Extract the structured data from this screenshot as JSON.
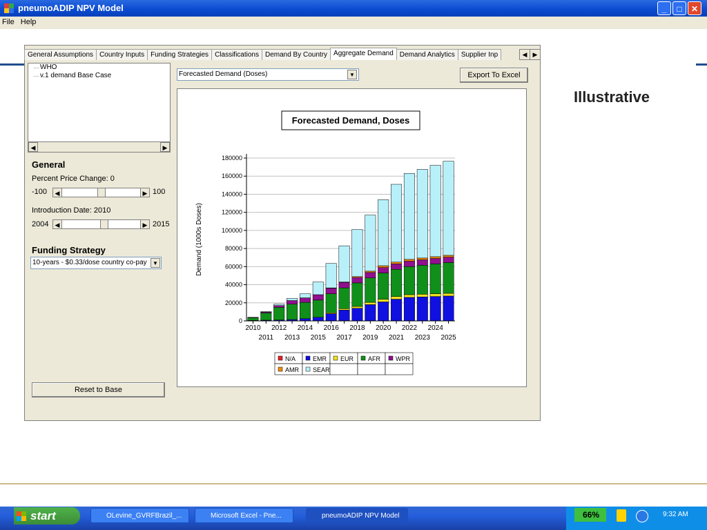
{
  "window": {
    "title": "pneumoADIP NPV Model"
  },
  "menu": [
    "File",
    "Help"
  ],
  "tabs": [
    "General Assumptions",
    "Country Inputs",
    "Funding Strategies",
    "Classifications",
    "Demand By Country",
    "Aggregate Demand",
    "Demand Analytics",
    "Supplier Inp"
  ],
  "tree": [
    "WHO",
    "v.1 demand Base Case"
  ],
  "general": {
    "heading": "General",
    "price_label": "Percent Price Change:",
    "price_value": "0",
    "price_min": "-100",
    "price_max": "100",
    "intro_label": "Introduction Date:",
    "intro_value": "2010",
    "intro_min": "2004",
    "intro_max": "2015",
    "price_slider_level": 0.5,
    "intro_slider_level": 0.5454
  },
  "funding": {
    "heading": "Funding Strategy",
    "value": "10-years - $0.33/dose country co-pay"
  },
  "reset_label": "Reset to Base",
  "view_select": "Forecasted Demand (Doses)",
  "export_label": "Export To Excel",
  "side_text": "Illustrative",
  "chart_data": {
    "type": "bar",
    "stacked": true,
    "title": "Forecasted Demand, Doses",
    "ylabel": "Demand (1000s Doses)",
    "xlabel": "",
    "ylim": [
      0,
      180000
    ],
    "yticks": [
      0,
      20000,
      40000,
      60000,
      80000,
      100000,
      120000,
      140000,
      160000,
      180000
    ],
    "categories": [
      "2010",
      "2011",
      "2012",
      "2013",
      "2014",
      "2015",
      "2016",
      "2017",
      "2018",
      "2019",
      "2020",
      "2021",
      "2022",
      "2023",
      "2024",
      "2025"
    ],
    "series": [
      {
        "name": "N/A",
        "color": "#e8202a",
        "values": [
          0,
          0,
          0,
          0,
          0,
          0,
          0,
          0,
          0,
          0,
          0,
          0,
          0,
          0,
          0,
          0
        ]
      },
      {
        "name": "EMR",
        "color": "#1010e0",
        "values": [
          500,
          800,
          1000,
          1500,
          2500,
          4000,
          8000,
          12000,
          14000,
          18000,
          21000,
          24000,
          26000,
          26500,
          27000,
          27500
        ]
      },
      {
        "name": "EUR",
        "color": "#f0e020",
        "values": [
          0,
          0,
          0,
          0,
          0,
          0,
          1000,
          1500,
          2000,
          2500,
          3000,
          3000,
          3000,
          3000,
          3000,
          3000
        ]
      },
      {
        "name": "AFR",
        "color": "#10901a",
        "values": [
          3000,
          8000,
          14000,
          17000,
          18000,
          19000,
          21000,
          23000,
          26000,
          27000,
          29000,
          30000,
          31000,
          32000,
          33000,
          34000
        ]
      },
      {
        "name": "WPR",
        "color": "#901090",
        "values": [
          500,
          1000,
          2000,
          4000,
          5000,
          6000,
          6000,
          6000,
          6000,
          6000,
          6000,
          6000,
          6000,
          6000,
          6000,
          6000
        ]
      },
      {
        "name": "AMR",
        "color": "#f08a10",
        "values": [
          0,
          0,
          0,
          0,
          0,
          0,
          500,
          500,
          1000,
          1500,
          2000,
          2000,
          2000,
          2000,
          2000,
          2000
        ]
      },
      {
        "name": "SEAR",
        "color": "#b8f0fa",
        "values": [
          0,
          500,
          1500,
          2500,
          4500,
          14000,
          27000,
          40000,
          52000,
          62000,
          73000,
          86000,
          95000,
          98000,
          101000,
          104000
        ]
      }
    ]
  },
  "taskbar": {
    "start": "start",
    "items": [
      "OLevine_GVRFBrazil_...",
      "Microsoft Excel - Pne...",
      "pneumoADIP NPV Model"
    ],
    "battery": "66%",
    "clock": "9:32 AM"
  }
}
